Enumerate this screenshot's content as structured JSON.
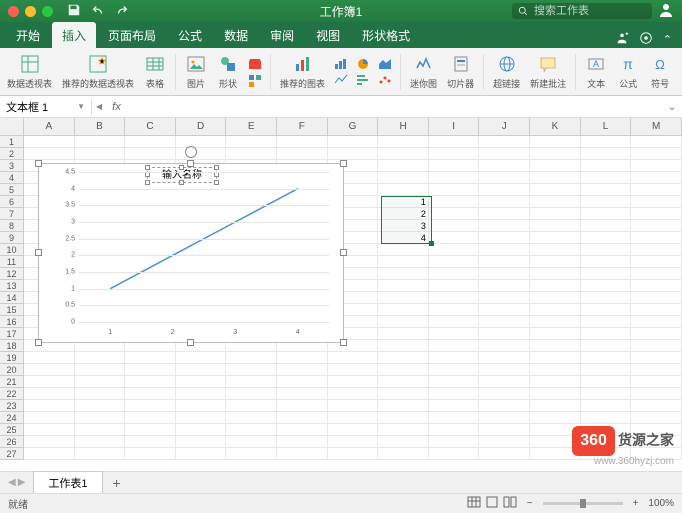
{
  "titlebar": {
    "title": "工作簿1",
    "search_placeholder": "搜索工作表"
  },
  "tabs": {
    "items": [
      "开始",
      "插入",
      "页面布局",
      "公式",
      "数据",
      "审阅",
      "视图",
      "形状格式"
    ],
    "active_index": 1
  },
  "ribbon": {
    "pivot1": "数据透视表",
    "pivot2": "推荐的数据透视表",
    "table": "表格",
    "picture": "图片",
    "shapes": "形状",
    "rec_charts": "推荐的图表",
    "sparkline": "迷你图",
    "slicer": "切片器",
    "hyperlink": "超链接",
    "comment": "新建批注",
    "textbox": "文本",
    "equation": "公式",
    "symbol": "符号"
  },
  "namebox": {
    "value": "文本框 1",
    "fx": "fx"
  },
  "columns": [
    "A",
    "B",
    "C",
    "D",
    "E",
    "F",
    "G",
    "H",
    "I",
    "J",
    "K",
    "L",
    "M"
  ],
  "row_count": 27,
  "selection": {
    "col": 8,
    "row_start": 6,
    "row_end": 9
  },
  "cell_values": {
    "H6": "1",
    "H7": "2",
    "H8": "3",
    "H9": "4"
  },
  "chart_data": {
    "type": "line",
    "title": "输入名称",
    "categories": [
      1,
      2,
      3,
      4
    ],
    "values": [
      1,
      2,
      3,
      4
    ],
    "xlabel": "",
    "ylabel": "",
    "ylim": [
      0,
      4.5
    ],
    "yticks": [
      0,
      0.5,
      1,
      1.5,
      2,
      2.5,
      3,
      3.5,
      4,
      4.5
    ]
  },
  "sheets": {
    "active": "工作表1",
    "add": "+"
  },
  "status": {
    "ready": "就绪",
    "zoom": "100%",
    "minus": "−",
    "plus": "+"
  },
  "watermark": {
    "badge": "360",
    "text": "货源之家",
    "url": "www.360hyzj.com"
  }
}
